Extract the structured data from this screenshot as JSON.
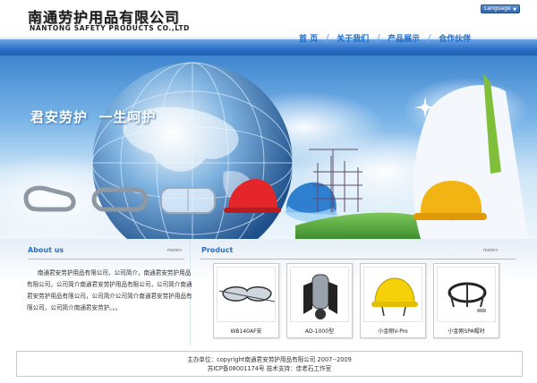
{
  "header": {
    "logo_cn": "南通劳护用品有限公司",
    "logo_en": "NANTONG SAFETY PRODUCTS CO.,LTD",
    "language_label": "Language"
  },
  "nav": {
    "items": [
      {
        "label": "首 页"
      },
      {
        "label": "关于我们"
      },
      {
        "label": "产品展示"
      },
      {
        "label": "合作伙伴"
      }
    ]
  },
  "banner": {
    "slogan": "君安劳护  一生呵护"
  },
  "about": {
    "title": "About us",
    "more": "more>",
    "text": "南通君安劳护用品有限公司，公司简介，南通君安劳护用品有限公司，公司简介南通君安劳护用品有限公司，公司简介南通君安劳护用品有限公司，公司简介公司简介南通君安劳护用品有限公司，公司简介南通君安劳护。。。"
  },
  "products": {
    "title": "Product",
    "more": "more>",
    "items": [
      {
        "caption": "WB140AF安",
        "icon": "goggles"
      },
      {
        "caption": "AD-1000型",
        "icon": "breathing-apparatus"
      },
      {
        "caption": "小金刚V-Pro",
        "icon": "yellow-hard-hat"
      },
      {
        "caption": "小金刚SPA帽衬",
        "icon": "helmet-suspension"
      }
    ]
  },
  "footer": {
    "line1": "主办单位：copyright南通君安劳护用品有限公司 2007--2009",
    "line2": "苏ICP备08001174号 技术支持：佳老石工作室"
  },
  "colors": {
    "nav_blue": "#1d69c4",
    "bar_blue": "#2f73c8",
    "title_blue": "#2b6fbf"
  }
}
